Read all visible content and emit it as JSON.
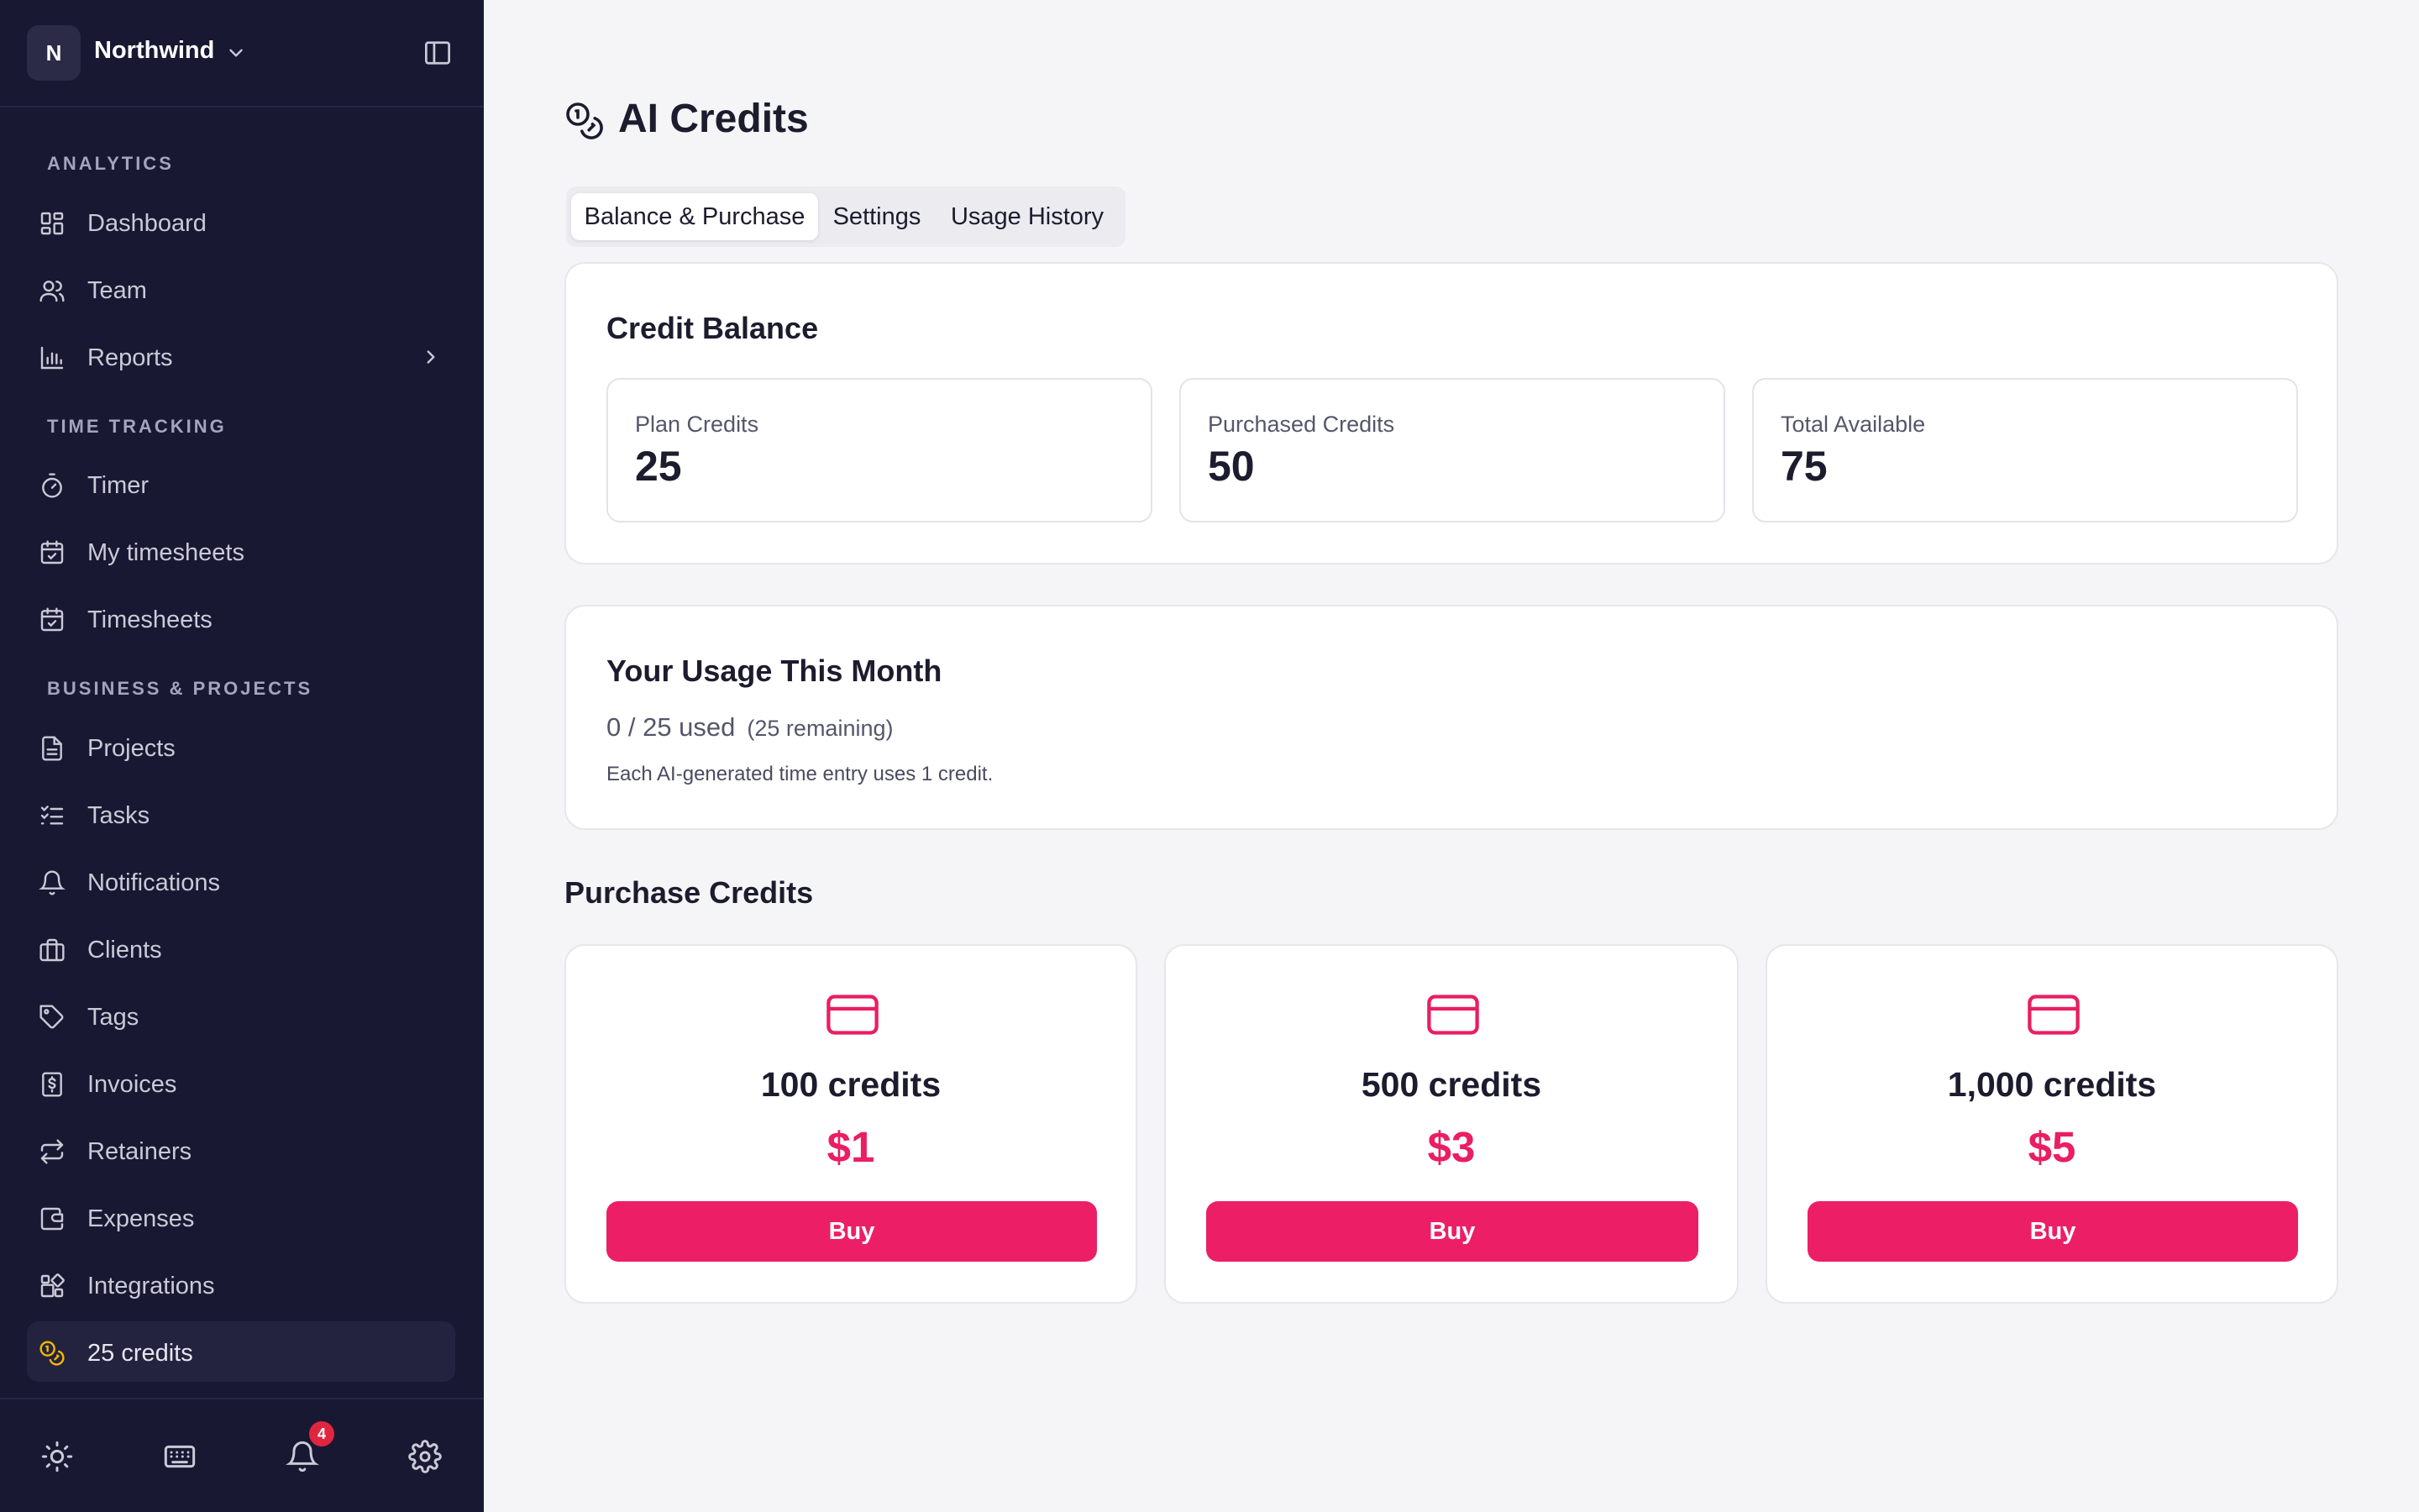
{
  "workspace": {
    "initial": "N",
    "name": "Northwind"
  },
  "sidebar": {
    "sections": [
      {
        "label": "ANALYTICS"
      },
      {
        "label": "TIME TRACKING"
      },
      {
        "label": "BUSINESS & PROJECTS"
      }
    ],
    "items": [
      {
        "label": "Dashboard",
        "icon": "dashboard-icon"
      },
      {
        "label": "Team",
        "icon": "users-icon"
      },
      {
        "label": "Reports",
        "icon": "bar-chart-icon"
      },
      {
        "label": "Timer",
        "icon": "stopwatch-icon"
      },
      {
        "label": "My timesheets",
        "icon": "calendar-check-icon"
      },
      {
        "label": "Timesheets",
        "icon": "calendar-check-icon"
      },
      {
        "label": "Projects",
        "icon": "document-icon"
      },
      {
        "label": "Tasks",
        "icon": "checklist-icon"
      },
      {
        "label": "Notifications",
        "icon": "bell-icon"
      },
      {
        "label": "Clients",
        "icon": "briefcase-icon"
      },
      {
        "label": "Tags",
        "icon": "tag-icon"
      },
      {
        "label": "Invoices",
        "icon": "invoice-icon"
      },
      {
        "label": "Retainers",
        "icon": "repeat-icon"
      },
      {
        "label": "Expenses",
        "icon": "wallet-icon"
      },
      {
        "label": "Integrations",
        "icon": "puzzle-icon"
      },
      {
        "label": "25 credits",
        "icon": "coins-icon"
      }
    ],
    "footer": {
      "notification_count": "4"
    }
  },
  "colors": {
    "sidebar_bg": "#181833",
    "accent": "#ec1f66",
    "credits_icon": "#f5b700",
    "badge": "#e0263e"
  },
  "page": {
    "title": "AI Credits",
    "tabs": [
      {
        "label": "Balance & Purchase",
        "active": true
      },
      {
        "label": "Settings",
        "active": false
      },
      {
        "label": "Usage History",
        "active": false
      }
    ]
  },
  "balance": {
    "title": "Credit Balance",
    "stats": [
      {
        "label": "Plan Credits",
        "value": "25"
      },
      {
        "label": "Purchased Credits",
        "value": "50"
      },
      {
        "label": "Total Available",
        "value": "75"
      }
    ]
  },
  "usage": {
    "title": "Your Usage This Month",
    "used_text": "0 / 25 used",
    "remaining_text": "(25 remaining)",
    "note": "Each AI-generated time entry uses 1 credit."
  },
  "purchase": {
    "title": "Purchase Credits",
    "packages": [
      {
        "credits": "100 credits",
        "price": "$1",
        "button": "Buy"
      },
      {
        "credits": "500 credits",
        "price": "$3",
        "button": "Buy"
      },
      {
        "credits": "1,000 credits",
        "price": "$5",
        "button": "Buy"
      }
    ]
  }
}
